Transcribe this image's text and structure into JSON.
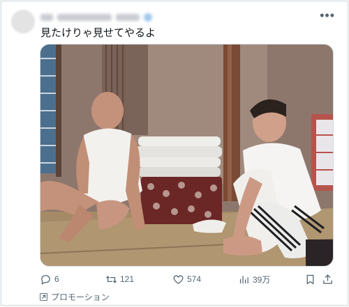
{
  "tweet": {
    "text": "見たけりゃ見せてやるよ"
  },
  "actions": {
    "replies": "6",
    "reposts": "121",
    "likes": "574",
    "views": "39万"
  },
  "promo": {
    "label": "プロモーション"
  },
  "icons": {
    "more": "more-dots-icon",
    "reply": "reply-icon",
    "repost": "repost-icon",
    "like": "heart-icon",
    "views": "views-bar-icon",
    "bookmark": "bookmark-icon",
    "share": "share-icon",
    "promo": "promoted-arrow-icon"
  },
  "colors": {
    "icon": "#536471",
    "text": "#0f1419",
    "border": "#cfd9de"
  }
}
